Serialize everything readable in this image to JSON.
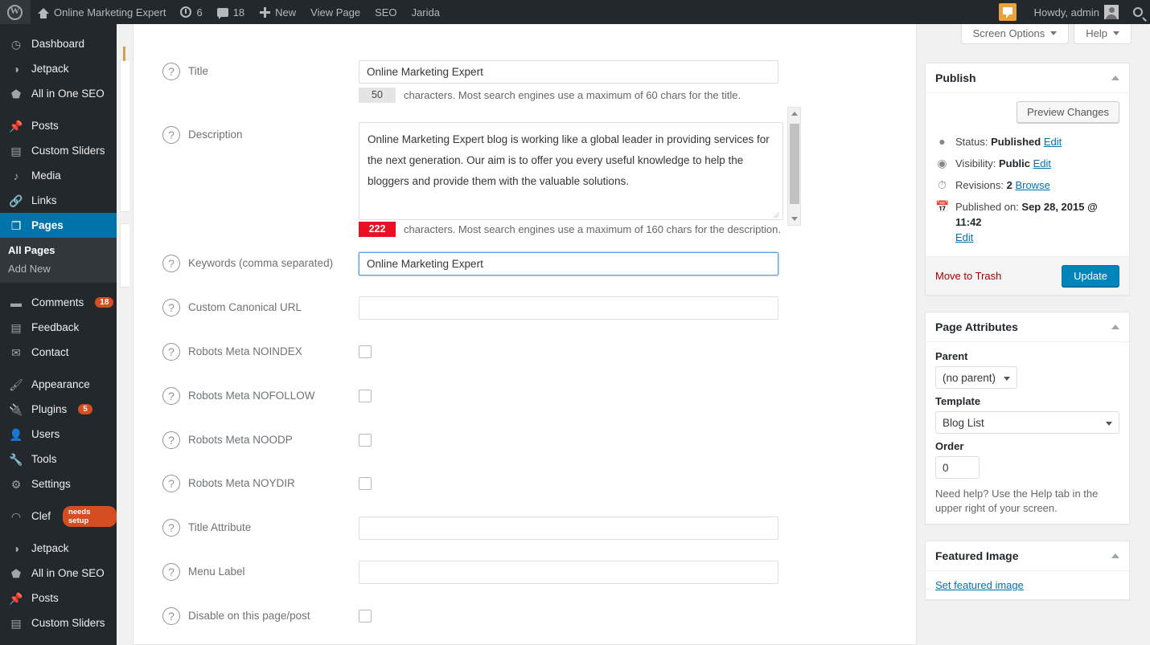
{
  "adminbar": {
    "site_name": "Online Marketing Expert",
    "updates_count": "6",
    "comments_count": "18",
    "new_label": "New",
    "view_page_label": "View Page",
    "seo_label": "SEO",
    "jarida_label": "Jarida",
    "howdy": "Howdy, admin"
  },
  "sidebar": {
    "items": [
      {
        "label": "Dashboard",
        "icon": "dashboard-icon",
        "glyph": "◷"
      },
      {
        "label": "Jetpack",
        "icon": "jetpack-icon",
        "glyph": "◑"
      },
      {
        "label": "All in One SEO",
        "icon": "shield-icon",
        "glyph": "⬟"
      },
      {
        "label": "Posts",
        "icon": "pin-icon",
        "glyph": "📌"
      },
      {
        "label": "Custom Sliders",
        "icon": "slider-icon",
        "glyph": "▤"
      },
      {
        "label": "Media",
        "icon": "media-icon",
        "glyph": "♪"
      },
      {
        "label": "Links",
        "icon": "link-icon",
        "glyph": "🔗"
      },
      {
        "label": "Pages",
        "icon": "page-icon",
        "glyph": "❐",
        "current": true
      },
      {
        "label": "Comments",
        "icon": "comment-icon",
        "glyph": "▬",
        "badge": "18"
      },
      {
        "label": "Feedback",
        "icon": "feedback-icon",
        "glyph": "▤"
      },
      {
        "label": "Contact",
        "icon": "envelope-icon",
        "glyph": "✉"
      },
      {
        "label": "Appearance",
        "icon": "brush-icon",
        "glyph": "🖌"
      },
      {
        "label": "Plugins",
        "icon": "plug-icon",
        "glyph": "🔌",
        "badge": "5"
      },
      {
        "label": "Users",
        "icon": "user-icon",
        "glyph": "👤"
      },
      {
        "label": "Tools",
        "icon": "wrench-icon",
        "glyph": "🔧"
      },
      {
        "label": "Settings",
        "icon": "settings-icon",
        "glyph": "⚙"
      },
      {
        "label": "Clef",
        "icon": "clef-icon",
        "glyph": "◠",
        "setup_badge": "needs setup"
      },
      {
        "label": "Jetpack",
        "icon": "jetpack-icon",
        "glyph": "◑"
      },
      {
        "label": "All in One SEO",
        "icon": "shield-icon",
        "glyph": "⬟"
      },
      {
        "label": "Posts",
        "icon": "pin-icon",
        "glyph": "📌"
      },
      {
        "label": "Custom Sliders",
        "icon": "slider-icon",
        "glyph": "▤"
      }
    ],
    "pages_submenu": [
      {
        "label": "All Pages",
        "current": true
      },
      {
        "label": "Add New",
        "current": false
      }
    ]
  },
  "screen_meta": {
    "screen_options": "Screen Options",
    "help": "Help"
  },
  "seo_form": {
    "rows": [
      {
        "label": "Title",
        "type": "text",
        "value": "Online Marketing Expert",
        "focused": false,
        "counter": "50",
        "counter_over": false,
        "counter_text": "characters. Most search engines use a maximum of 60 chars for the title."
      },
      {
        "label": "Description",
        "type": "textarea",
        "value": "Online Marketing Expert blog is working like a global leader in providing services for the next generation. Our aim is to offer you every useful knowledge to help the bloggers and provide them with the valuable solutions.",
        "counter": "222",
        "counter_over": true,
        "counter_text": "characters. Most search engines use a maximum of 160 chars for the description."
      },
      {
        "label": "Keywords (comma separated)",
        "type": "text",
        "value": "Online Marketing Expert",
        "focused": true
      },
      {
        "label": "Custom Canonical URL",
        "type": "text",
        "value": ""
      },
      {
        "label": "Robots Meta NOINDEX",
        "type": "checkbox",
        "checked": false
      },
      {
        "label": "Robots Meta NOFOLLOW",
        "type": "checkbox",
        "checked": false
      },
      {
        "label": "Robots Meta NOODP",
        "type": "checkbox",
        "checked": false
      },
      {
        "label": "Robots Meta NOYDIR",
        "type": "checkbox",
        "checked": false
      },
      {
        "label": "Title Attribute",
        "type": "text",
        "value": ""
      },
      {
        "label": "Menu Label",
        "type": "text",
        "value": ""
      },
      {
        "label": "Disable on this page/post",
        "type": "checkbox",
        "checked": false
      }
    ],
    "help_glyph": "?"
  },
  "publish_box": {
    "title": "Publish",
    "preview_button": "Preview Changes",
    "status_label": "Status:",
    "status_value": "Published",
    "status_edit": "Edit",
    "visibility_label": "Visibility:",
    "visibility_value": "Public",
    "visibility_edit": "Edit",
    "revisions_label": "Revisions:",
    "revisions_value": "2",
    "revisions_browse": "Browse",
    "published_label": "Published on:",
    "published_value": "Sep 28, 2015 @ 11:42",
    "published_edit": "Edit",
    "trash_label": "Move to Trash",
    "update_label": "Update"
  },
  "page_attributes": {
    "title": "Page Attributes",
    "parent_label": "Parent",
    "parent_value": "(no parent)",
    "template_label": "Template",
    "template_value": "Blog List",
    "order_label": "Order",
    "order_value": "0",
    "help_note": "Need help? Use the Help tab in the upper right of your screen."
  },
  "featured_image": {
    "title": "Featured Image",
    "set_link": "Set featured image"
  },
  "colors": {
    "admin_bar": "#23282d",
    "sidebar_current": "#0073aa",
    "primary_button": "#0085ba",
    "link": "#0073aa",
    "counter_over": "#e81123",
    "badge": "#d54e21"
  }
}
